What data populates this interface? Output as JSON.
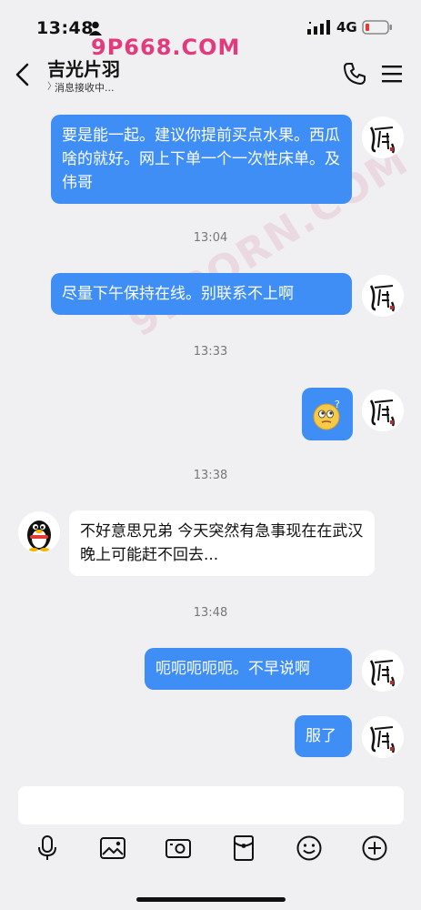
{
  "status": {
    "time": "13:48",
    "network": "4G"
  },
  "header": {
    "title": "吉光片羽",
    "subtitle": "消息接收中...",
    "subtitle_mark": "〉"
  },
  "watermark": {
    "top": "9P668.COM",
    "diag": "91PORN.COM"
  },
  "messages": [
    {
      "type": "out",
      "text": "要是能一起。建议你提前买点水果。西瓜啥的就好。网上下单一个一次性床单。及伟哥"
    },
    {
      "type": "time",
      "text": "13:04"
    },
    {
      "type": "out",
      "text": "尽量下午保持在线。别联系不上啊"
    },
    {
      "type": "time",
      "text": "13:33"
    },
    {
      "type": "out_emoji",
      "emoji": "thinking-face-icon"
    },
    {
      "type": "time",
      "text": "13:38"
    },
    {
      "type": "in",
      "text": "不好意思兄弟 今天突然有急事现在在武汉 晚上可能赶不回去..."
    },
    {
      "type": "time",
      "text": "13:48"
    },
    {
      "type": "out",
      "text": "呃呃呃呃呃。不早说啊"
    },
    {
      "type": "out",
      "text": "服了"
    }
  ],
  "toolbar": [
    "microphone-icon",
    "image-icon",
    "camera-icon",
    "red-packet-icon",
    "emoji-icon",
    "plus-icon"
  ],
  "colors": {
    "bubble_out": "#3f8ef5",
    "background": "#f0f0f2",
    "watermark": "#e23a7c",
    "battery_low": "#e53935"
  }
}
